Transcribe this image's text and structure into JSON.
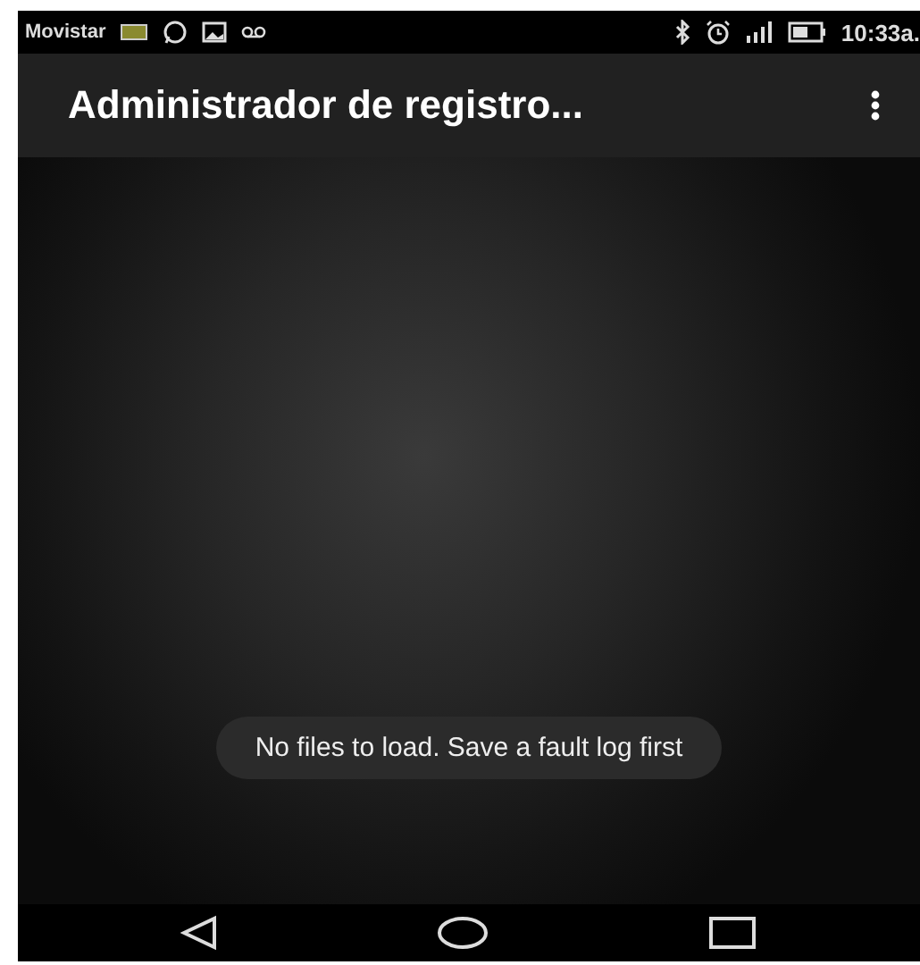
{
  "status_bar": {
    "carrier": "Movistar",
    "time": "10:33a."
  },
  "app_bar": {
    "title": "Administrador de registro..."
  },
  "toast": {
    "text": "No files to load. Save a fault log first"
  }
}
